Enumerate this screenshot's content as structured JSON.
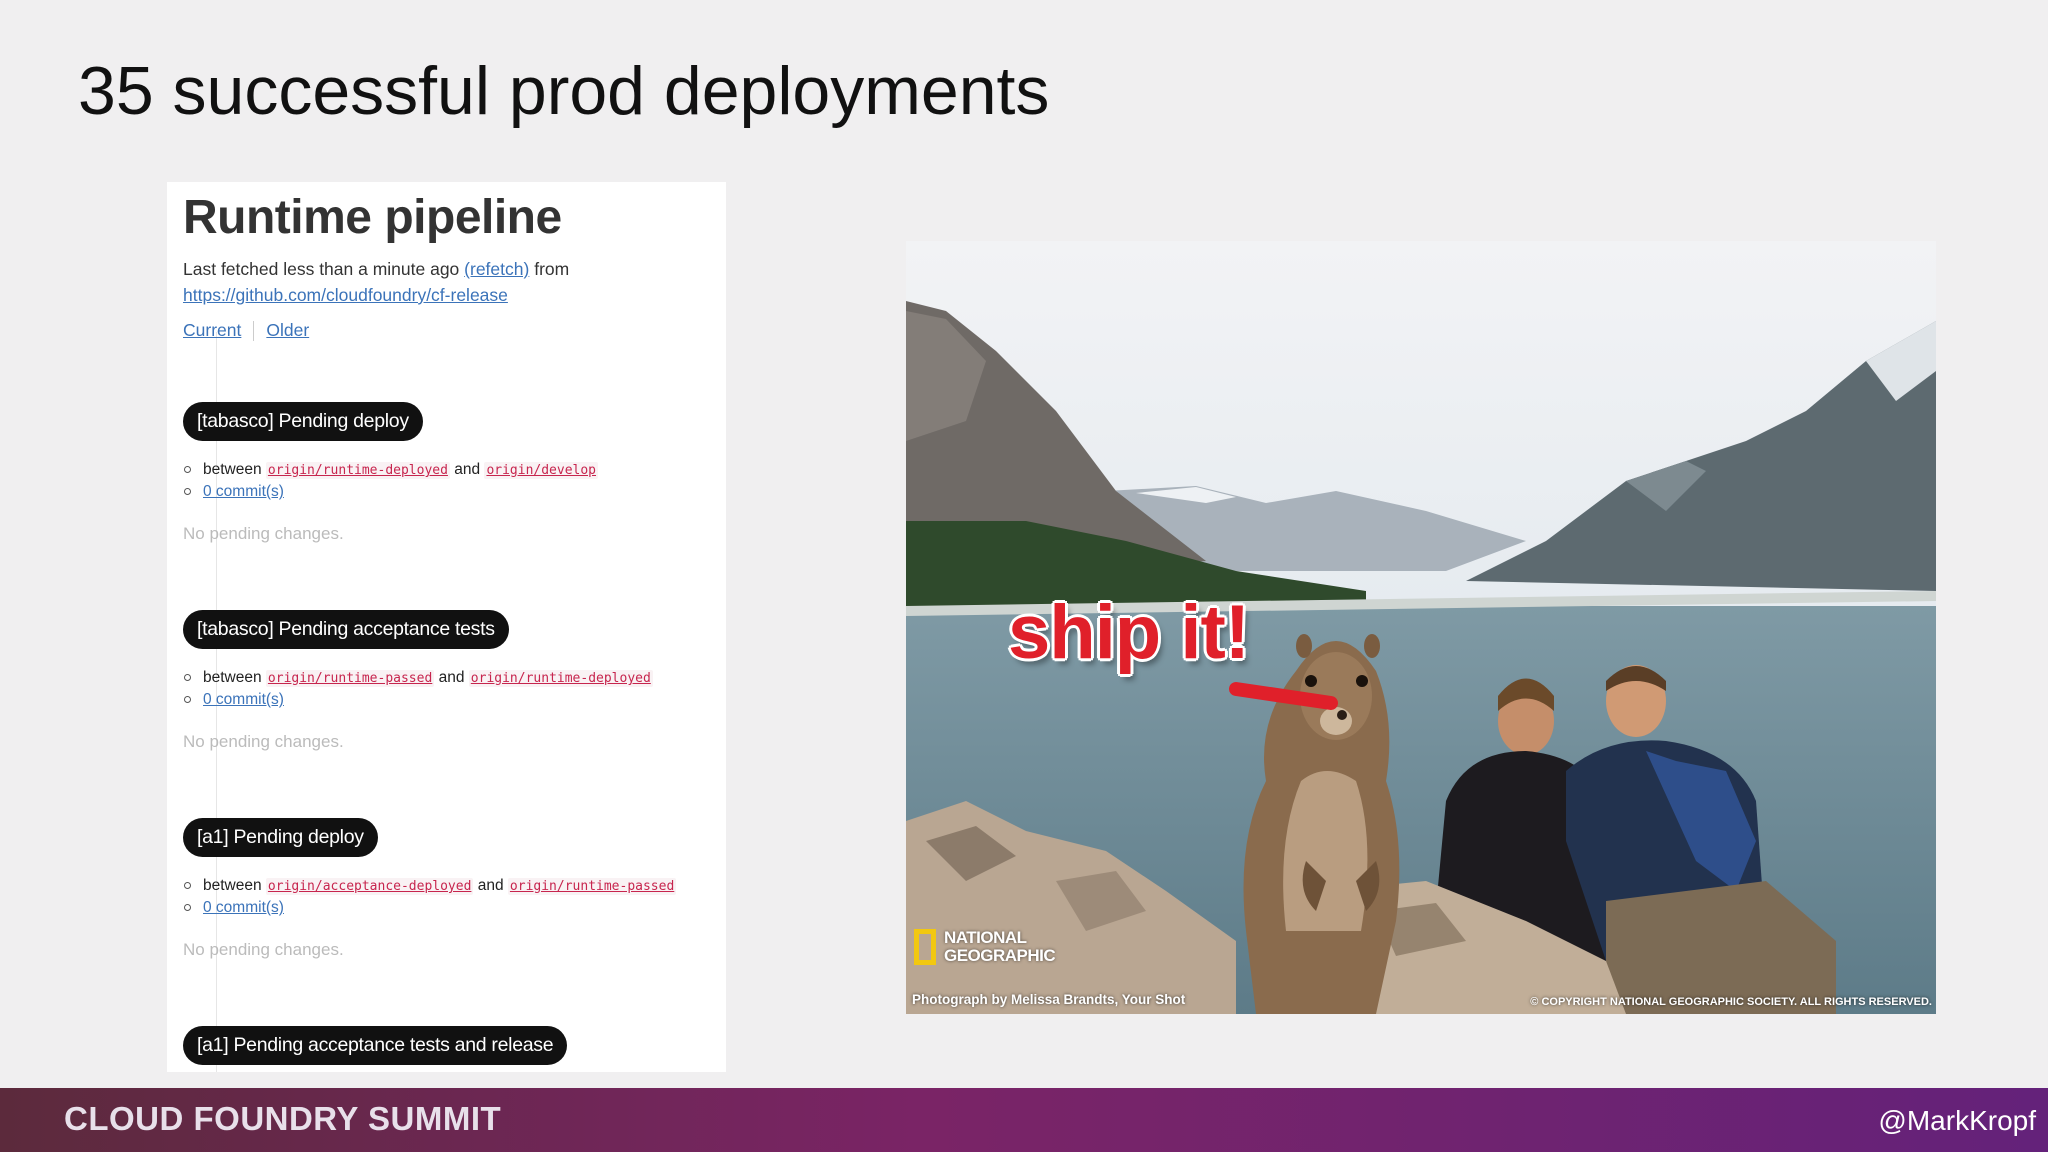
{
  "slide": {
    "title": "35 successful prod deployments"
  },
  "pipeline": {
    "heading": "Runtime pipeline",
    "fetched_text": "Last fetched less than a minute ago",
    "refetch_link": "(refetch)",
    "from_text": "from",
    "repo_link": "https://github.com/cloudfoundry/cf-release",
    "nav": {
      "current": "Current",
      "older": "Older"
    },
    "sections": [
      {
        "pill": "[tabasco] Pending deploy",
        "between": "between",
        "ref_a": "origin/runtime-deployed",
        "and": "and",
        "ref_b": "origin/develop",
        "commits": "0 commit(s)",
        "no_pending": "No pending changes."
      },
      {
        "pill": "[tabasco] Pending acceptance tests",
        "between": "between",
        "ref_a": "origin/runtime-passed",
        "and": "and",
        "ref_b": "origin/runtime-deployed",
        "commits": "0 commit(s)",
        "no_pending": "No pending changes."
      },
      {
        "pill": "[a1] Pending deploy",
        "between": "between",
        "ref_a": "origin/acceptance-deployed",
        "and": "and",
        "ref_b": "origin/runtime-passed",
        "commits": "0 commit(s)",
        "no_pending": "No pending changes."
      },
      {
        "pill": "[a1] Pending acceptance tests and release"
      }
    ]
  },
  "photo": {
    "caption": "ship it!",
    "logo_line1": "NATIONAL",
    "logo_line2": "GEOGRAPHIC",
    "credit": "Photograph by Melissa Brandts, Your Shot",
    "copyright": "© COPYRIGHT NATIONAL GEOGRAPHIC SOCIETY. ALL RIGHTS RESERVED."
  },
  "footer": {
    "brand": "CLOUD FOUNDRY SUMMIT",
    "handle": "@MarkKropf"
  },
  "colors": {
    "footer_start": "#5c2a3c",
    "footer_end": "#64227a",
    "link": "#3b73b9",
    "code_ref": "#c7254e",
    "caption_red": "#e0202a",
    "logo_yellow": "#f2c80f"
  }
}
